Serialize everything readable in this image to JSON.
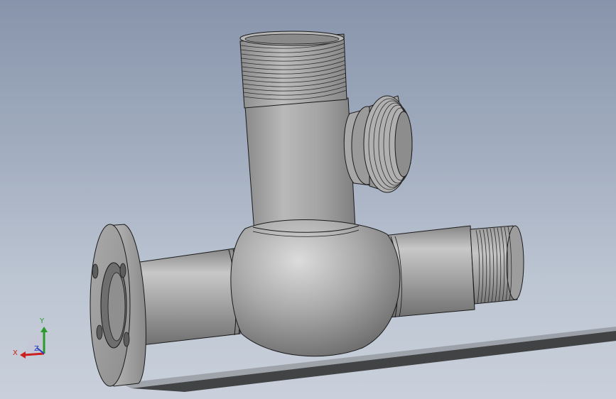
{
  "viewport": {
    "background_top": "#8794ab",
    "background_bottom": "#c9d0db"
  },
  "model": {
    "part_type": "valve-body-3d-model",
    "shade_color": "#9b9b9b",
    "edge_color": "#1a1a1a"
  },
  "triad": {
    "x_label": "X",
    "y_label": "Y",
    "z_label": "Z",
    "x_color": "#cc1f1f",
    "y_color": "#2a9a2a",
    "z_color": "#2a3fbf"
  }
}
